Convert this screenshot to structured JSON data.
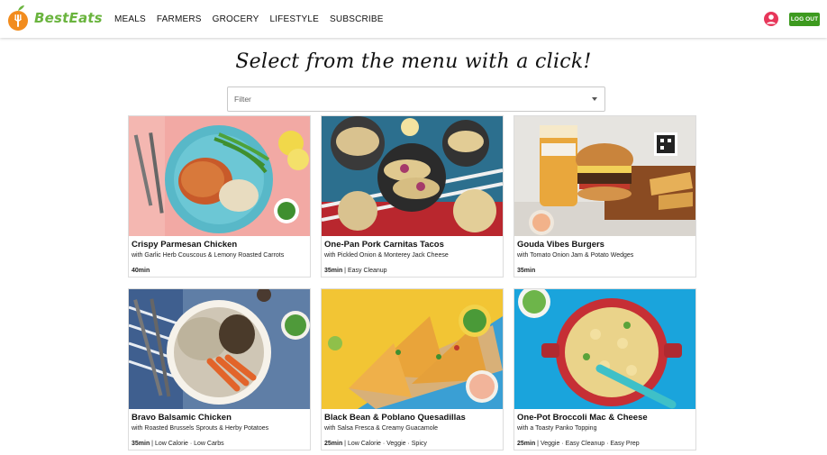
{
  "header": {
    "brand": "BestEats",
    "nav": [
      "MEALS",
      "FARMERS",
      "GROCERY",
      "LIFESTYLE",
      "SUBSCRIBE"
    ],
    "logout_label": "LOG OUT",
    "colors": {
      "brand": "#6ab43e",
      "logo_orange": "#f28c1e",
      "avatar": "#e7365a",
      "logout_bg": "#3d9a1f"
    }
  },
  "page": {
    "headline": "Select from the menu with a click!",
    "filter_placeholder": "Filter"
  },
  "meals": [
    {
      "title": "Crispy Parmesan Chicken",
      "subtitle": "with Garlic Herb Couscous & Lemony Roasted Carrots",
      "time": "40min",
      "tags": ""
    },
    {
      "title": "One-Pan Pork Carnitas Tacos",
      "subtitle": "with Pickled Onion & Monterey Jack Cheese",
      "time": "35min",
      "tags": "Easy Cleanup"
    },
    {
      "title": "Gouda Vibes Burgers",
      "subtitle": "with Tomato Onion Jam & Potato Wedges",
      "time": "35min",
      "tags": ""
    },
    {
      "title": "Bravo Balsamic Chicken",
      "subtitle": "with Roasted Brussels Sprouts & Herby Potatoes",
      "time": "35min",
      "tags": "Low Calorie · Low Carbs"
    },
    {
      "title": "Black Bean & Poblano Quesadillas",
      "subtitle": "with Salsa Fresca & Creamy Guacamole",
      "time": "25min",
      "tags": "Low Calorie · Veggie · Spicy"
    },
    {
      "title": "One-Pot Broccoli Mac & Cheese",
      "subtitle": "with a Toasty Panko Topping",
      "time": "25min",
      "tags": "Veggie · Easy Cleanup · Easy Prep"
    }
  ]
}
